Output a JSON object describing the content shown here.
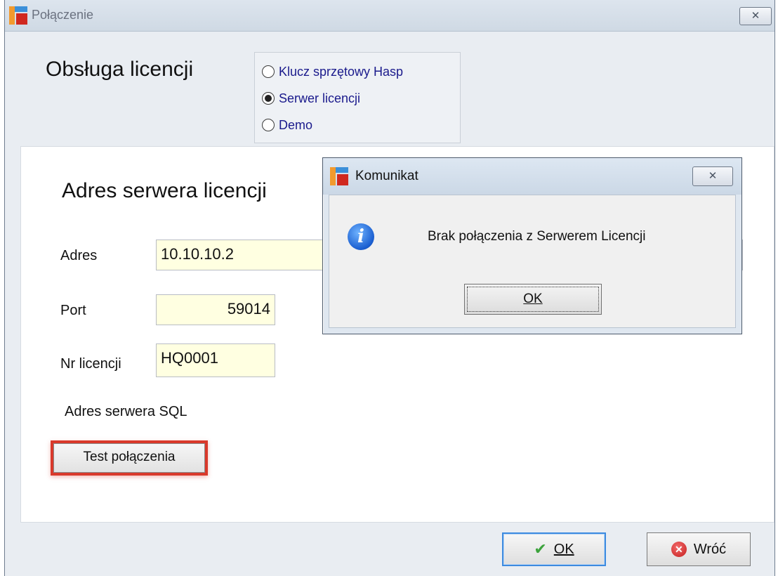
{
  "window": {
    "title": "Połączenie",
    "close_label": "✕"
  },
  "license": {
    "heading": "Obsługa licencji",
    "options": [
      {
        "label": "Klucz sprzętowy Hasp",
        "checked": false
      },
      {
        "label": "Serwer licencji",
        "checked": true
      },
      {
        "label": "Demo",
        "checked": false
      }
    ]
  },
  "server": {
    "heading": "Adres serwera licencji",
    "address_label": "Adres",
    "address_value": "10.10.10.2",
    "port_label": "Port",
    "port_value": "59014",
    "license_no_label": "Nr  licencji",
    "license_no_value": "HQ0001",
    "sql_label": "Adres serwera SQL",
    "test_button": "Test połączenia"
  },
  "dialog": {
    "title": "Komunikat",
    "close_label": "✕",
    "message": "Brak połączenia z Serwerem Licencji",
    "ok_label": "OK"
  },
  "footer": {
    "ok_label": "OK",
    "back_label": "Wróć"
  },
  "colors": {
    "field_bg": "#ffffe1",
    "highlight": "#d9392b"
  }
}
